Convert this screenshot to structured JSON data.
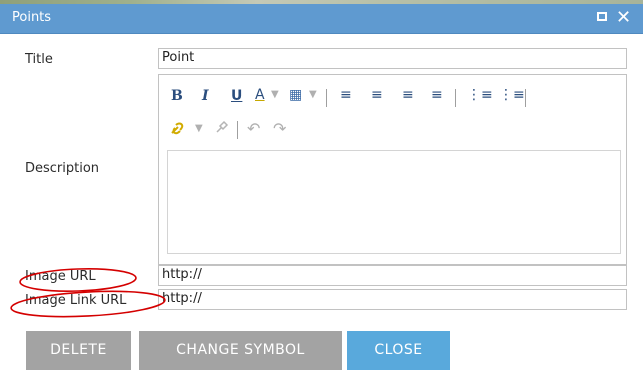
{
  "window": {
    "title": "Points",
    "maximize_icon": "maximize-icon",
    "close_icon": "close-icon",
    "close_glyph": "✕",
    "titlebar_color": "#5f9ad0"
  },
  "form": {
    "title_label": "Title",
    "title_value": "Point",
    "description_label": "Description",
    "image_url_label": "Image URL",
    "image_url_value": "http://",
    "image_link_url_label": "Image Link URL",
    "image_link_url_value": "http://"
  },
  "toolbar": {
    "row1": [
      {
        "name": "bold-icon",
        "glyph": "B"
      },
      {
        "name": "italic-icon",
        "glyph": "I"
      },
      {
        "name": "underline-icon",
        "glyph": "U"
      },
      {
        "name": "font-color-icon",
        "glyph": "A"
      },
      {
        "name": "highlight-color-icon",
        "glyph": "▦"
      },
      {
        "name": "align-left-icon",
        "glyph": "≡"
      },
      {
        "name": "align-center-icon",
        "glyph": "≡"
      },
      {
        "name": "align-right-icon",
        "glyph": "≡"
      },
      {
        "name": "align-justify-icon",
        "glyph": "≡"
      },
      {
        "name": "numbered-list-icon",
        "glyph": "⋮≡"
      },
      {
        "name": "bullet-list-icon",
        "glyph": "⋮≡"
      }
    ],
    "row2": [
      {
        "name": "link-icon",
        "glyph": "🔗"
      },
      {
        "name": "unlink-icon",
        "glyph": "⚲"
      },
      {
        "name": "undo-icon",
        "glyph": "↶"
      },
      {
        "name": "redo-icon",
        "glyph": "↷"
      }
    ]
  },
  "buttons": {
    "delete": "DELETE",
    "change_symbol": "CHANGE SYMBOL",
    "close": "CLOSE"
  },
  "colors": {
    "button_gray": "#a3a3a3",
    "button_blue": "#59a9dc",
    "annotation_red": "#d40000"
  }
}
